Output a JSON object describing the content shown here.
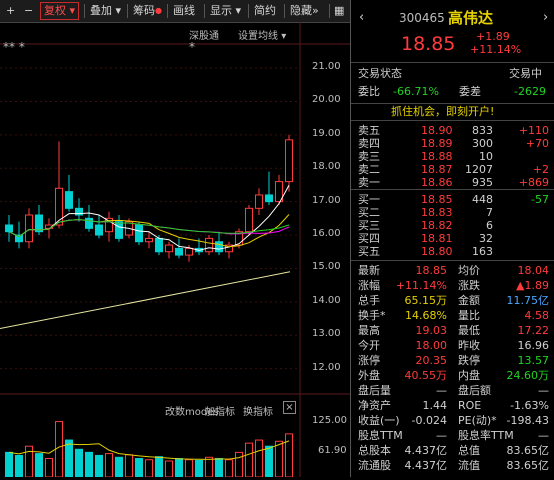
{
  "toolbar": {
    "plus": "+",
    "minus": "−",
    "fuquan": "复权",
    "diejia": "叠加",
    "chouma": "筹码",
    "huaxian": "画线",
    "xianshi": "显示",
    "jianyue": "简约",
    "yincang": "隐藏"
  },
  "chart": {
    "stars_left": "**  *",
    "star_mid": "*",
    "shengutong": "深股通",
    "settings": "设置均线",
    "y_ticks": [
      "21.00",
      "20.00",
      "19.00",
      "18.00",
      "17.00",
      "16.00",
      "15.00",
      "14.00",
      "13.00",
      "12.00"
    ],
    "sub_labels": {
      "moni": "改数modes",
      "zhibiao_add": "加指标",
      "zhibiao_swap": "换指标"
    },
    "vol_ticks": [
      "125.00",
      "61.90"
    ],
    "colors": {
      "bg": "#000000",
      "up": "#ff3b3b",
      "down": "#00d0d0",
      "ma5": "#ffffff",
      "ma10": "#e6d200",
      "ma20": "#ff00ff",
      "ma30": "#22d322",
      "ma60": "#e6e6a0"
    }
  },
  "chart_data": {
    "type": "candlestick",
    "ylim": [
      11.6,
      21.6
    ],
    "candles": [
      {
        "o": 16.3,
        "h": 16.6,
        "l": 15.8,
        "c": 16.1
      },
      {
        "o": 16.0,
        "h": 16.4,
        "l": 15.6,
        "c": 15.8
      },
      {
        "o": 15.8,
        "h": 16.8,
        "l": 15.6,
        "c": 16.6
      },
      {
        "o": 16.6,
        "h": 16.9,
        "l": 16.0,
        "c": 16.1
      },
      {
        "o": 16.2,
        "h": 16.5,
        "l": 15.9,
        "c": 16.3
      },
      {
        "o": 16.3,
        "h": 18.8,
        "l": 16.2,
        "c": 17.4
      },
      {
        "o": 17.3,
        "h": 17.8,
        "l": 16.7,
        "c": 16.8
      },
      {
        "o": 16.8,
        "h": 17.1,
        "l": 16.4,
        "c": 16.6
      },
      {
        "o": 16.5,
        "h": 16.9,
        "l": 16.1,
        "c": 16.2
      },
      {
        "o": 16.3,
        "h": 16.6,
        "l": 15.9,
        "c": 16.0
      },
      {
        "o": 16.1,
        "h": 16.7,
        "l": 15.8,
        "c": 16.5
      },
      {
        "o": 16.4,
        "h": 16.6,
        "l": 15.8,
        "c": 15.9
      },
      {
        "o": 16.0,
        "h": 16.5,
        "l": 15.9,
        "c": 16.4
      },
      {
        "o": 16.3,
        "h": 16.4,
        "l": 15.7,
        "c": 15.8
      },
      {
        "o": 15.8,
        "h": 16.1,
        "l": 15.6,
        "c": 15.9
      },
      {
        "o": 15.9,
        "h": 16.0,
        "l": 15.4,
        "c": 15.5
      },
      {
        "o": 15.5,
        "h": 15.8,
        "l": 15.3,
        "c": 15.7
      },
      {
        "o": 15.6,
        "h": 15.9,
        "l": 15.3,
        "c": 15.4
      },
      {
        "o": 15.4,
        "h": 15.7,
        "l": 15.2,
        "c": 15.6
      },
      {
        "o": 15.6,
        "h": 15.9,
        "l": 15.4,
        "c": 15.5
      },
      {
        "o": 15.5,
        "h": 16.0,
        "l": 15.4,
        "c": 15.9
      },
      {
        "o": 15.8,
        "h": 16.1,
        "l": 15.4,
        "c": 15.5
      },
      {
        "o": 15.5,
        "h": 15.8,
        "l": 15.3,
        "c": 15.7
      },
      {
        "o": 15.7,
        "h": 16.2,
        "l": 15.6,
        "c": 16.1
      },
      {
        "o": 16.1,
        "h": 16.9,
        "l": 16.0,
        "c": 16.8
      },
      {
        "o": 16.8,
        "h": 17.4,
        "l": 16.6,
        "c": 17.2
      },
      {
        "o": 17.2,
        "h": 17.9,
        "l": 16.9,
        "c": 17.0
      },
      {
        "o": 17.0,
        "h": 17.8,
        "l": 16.9,
        "c": 17.6
      },
      {
        "o": 17.6,
        "h": 19.0,
        "l": 17.3,
        "c": 18.85
      }
    ],
    "volume_ylim": [
      0,
      125
    ],
    "volumes": [
      40,
      35,
      50,
      38,
      30,
      90,
      60,
      45,
      40,
      35,
      38,
      32,
      36,
      30,
      28,
      33,
      26,
      30,
      28,
      27,
      32,
      30,
      28,
      40,
      55,
      60,
      50,
      58,
      70
    ]
  },
  "quote": {
    "code": "300465",
    "name": "高伟达",
    "price": "18.85",
    "change": "+1.89",
    "change_pct": "+11.14%",
    "trade_state_label": "交易状态",
    "trade_state": "交易中",
    "weibi_label": "委比",
    "weibi": "-66.71%",
    "weicha_label": "委差",
    "weicha": "-2629",
    "ad": "抓住机会，即刻开户!"
  },
  "asks": [
    {
      "label": "卖五",
      "price": "18.90",
      "vol": "833",
      "chg": "+110"
    },
    {
      "label": "卖四",
      "price": "18.89",
      "vol": "300",
      "chg": "+70"
    },
    {
      "label": "卖三",
      "price": "18.88",
      "vol": "10",
      "chg": ""
    },
    {
      "label": "卖二",
      "price": "18.87",
      "vol": "1207",
      "chg": "+2"
    },
    {
      "label": "卖一",
      "price": "18.86",
      "vol": "935",
      "chg": "+869"
    }
  ],
  "bids": [
    {
      "label": "买一",
      "price": "18.85",
      "vol": "448",
      "chg": "-57"
    },
    {
      "label": "买二",
      "price": "18.83",
      "vol": "7",
      "chg": ""
    },
    {
      "label": "买三",
      "price": "18.82",
      "vol": "6",
      "chg": ""
    },
    {
      "label": "买四",
      "price": "18.81",
      "vol": "32",
      "chg": ""
    },
    {
      "label": "买五",
      "price": "18.80",
      "vol": "163",
      "chg": ""
    }
  ],
  "stats": [
    {
      "l1": "最新",
      "v1": "18.85",
      "c1": "r",
      "l2": "均价",
      "v2": "18.04",
      "c2": "r"
    },
    {
      "l1": "涨幅",
      "v1": "+11.14%",
      "c1": "r",
      "l2": "涨跌",
      "v2": "▲1.89",
      "c2": "r"
    },
    {
      "l1": "总手",
      "v1": "65.15万",
      "c1": "y",
      "l2": "金额",
      "v2": "11.75亿",
      "c2": "b"
    },
    {
      "l1": "换手*",
      "v1": "14.68%",
      "c1": "y",
      "l2": "量比",
      "v2": "4.58",
      "c2": "r"
    },
    {
      "l1": "最高",
      "v1": "19.03",
      "c1": "r",
      "l2": "最低",
      "v2": "17.22",
      "c2": "r"
    },
    {
      "l1": "今开",
      "v1": "18.00",
      "c1": "r",
      "l2": "昨收",
      "v2": "16.96",
      "c2": "w"
    },
    {
      "l1": "涨停",
      "v1": "20.35",
      "c1": "r",
      "l2": "跌停",
      "v2": "13.57",
      "c2": "g"
    },
    {
      "l1": "外盘",
      "v1": "40.55万",
      "c1": "r",
      "l2": "内盘",
      "v2": "24.60万",
      "c2": "g"
    },
    {
      "l1": "盘后量",
      "v1": "—",
      "c1": "w",
      "l2": "盘后额",
      "v2": "—",
      "c2": "w"
    },
    {
      "l1": "净资产",
      "v1": "1.44",
      "c1": "w",
      "l2": "ROE",
      "v2": "-1.63%",
      "c2": "w"
    },
    {
      "l1": "收益(一)",
      "v1": "-0.024",
      "c1": "w",
      "l2": "PE(动)*",
      "v2": "-198.43",
      "c2": "w"
    },
    {
      "l1": "股息TTM",
      "v1": "—",
      "c1": "w",
      "l2": "股息率TTM",
      "v2": "—",
      "c2": "w"
    },
    {
      "l1": "总股本",
      "v1": "4.437亿",
      "c1": "w",
      "l2": "总值",
      "v2": "83.65亿",
      "c2": "w"
    },
    {
      "l1": "流通股",
      "v1": "4.437亿",
      "c1": "w",
      "l2": "流值",
      "v2": "83.65亿",
      "c2": "w"
    }
  ]
}
